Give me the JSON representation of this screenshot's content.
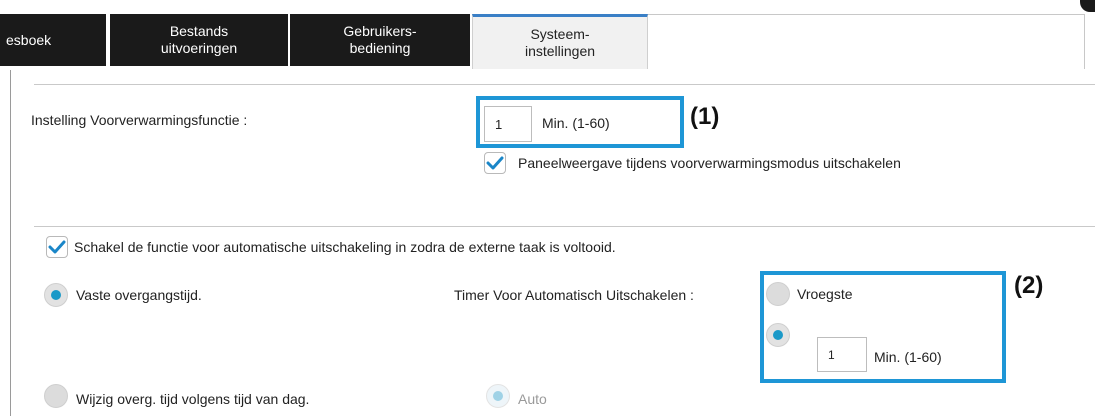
{
  "tabs": [
    {
      "label": "esboek"
    },
    {
      "label": "Bestands uitvoeringen"
    },
    {
      "label": "Gebruikers- bediening"
    },
    {
      "label": "Systeem- instellingen"
    }
  ],
  "preheat": {
    "label": "Instelling Voorverwarmingsfunctie :",
    "value": "1",
    "unit": "Min. (1-60)",
    "callout": "(1)",
    "panel_checkbox_label": "Paneelweergave tijdens voorverwarmingsmodus uitschakelen",
    "panel_checked": true
  },
  "auto_off": {
    "enable_label": "Schakel de functie voor automatische uitschakeling in zodra de externe taak is voltooid.",
    "enable_checked": true,
    "fixed_label": "Vaste overgangstijd.",
    "timer_label": "Timer Voor Automatisch Uitschakelen :",
    "earliest_label": "Vroegste",
    "custom_value": "1",
    "custom_unit": "Min.  (1-60)",
    "callout": "(2)",
    "by_time_label": "Wijzig overg. tijd volgens tijd van dag.",
    "auto_label": "Auto"
  },
  "colors": {
    "accent_blue": "#1e96d6",
    "radio_blue": "#1a99c8",
    "tab_dark": "#1a1a1a"
  }
}
